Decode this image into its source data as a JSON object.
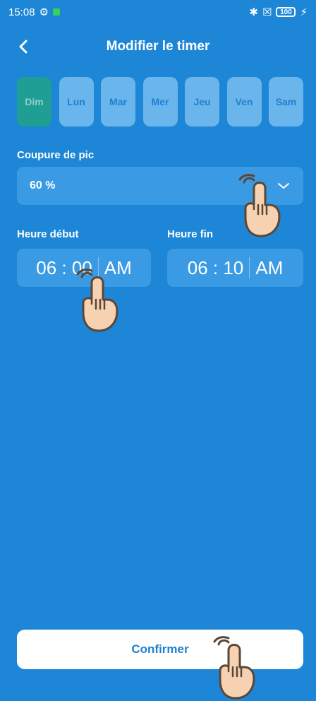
{
  "status_bar": {
    "time": "15:08",
    "battery": "100",
    "icons": [
      "settings-off-icon",
      "green-square-icon",
      "bluetooth-icon",
      "close-box-icon",
      "battery-icon",
      "charging-icon"
    ]
  },
  "header": {
    "back_icon": "back-icon",
    "title": "Modifier le timer"
  },
  "days": [
    {
      "label": "Dim",
      "selected": true
    },
    {
      "label": "Lun",
      "selected": false
    },
    {
      "label": "Mar",
      "selected": false
    },
    {
      "label": "Mer",
      "selected": false
    },
    {
      "label": "Jeu",
      "selected": false
    },
    {
      "label": "Ven",
      "selected": false
    },
    {
      "label": "Sam",
      "selected": false
    }
  ],
  "peak_cut": {
    "label": "Coupure de pic",
    "value": "60 %",
    "icon": "chevron-down-icon"
  },
  "start_time": {
    "label": "Heure début",
    "value": "06 : 00",
    "period": "AM"
  },
  "end_time": {
    "label": "Heure fin",
    "value": "06 : 10",
    "period": "AM"
  },
  "confirm_label": "Confirmer",
  "colors": {
    "background": "#1e86d6",
    "day_button": "#6ab6ec",
    "day_selected": "#1f9f93",
    "field": "#3a9ae3",
    "confirm_text": "#1f7fd0"
  }
}
